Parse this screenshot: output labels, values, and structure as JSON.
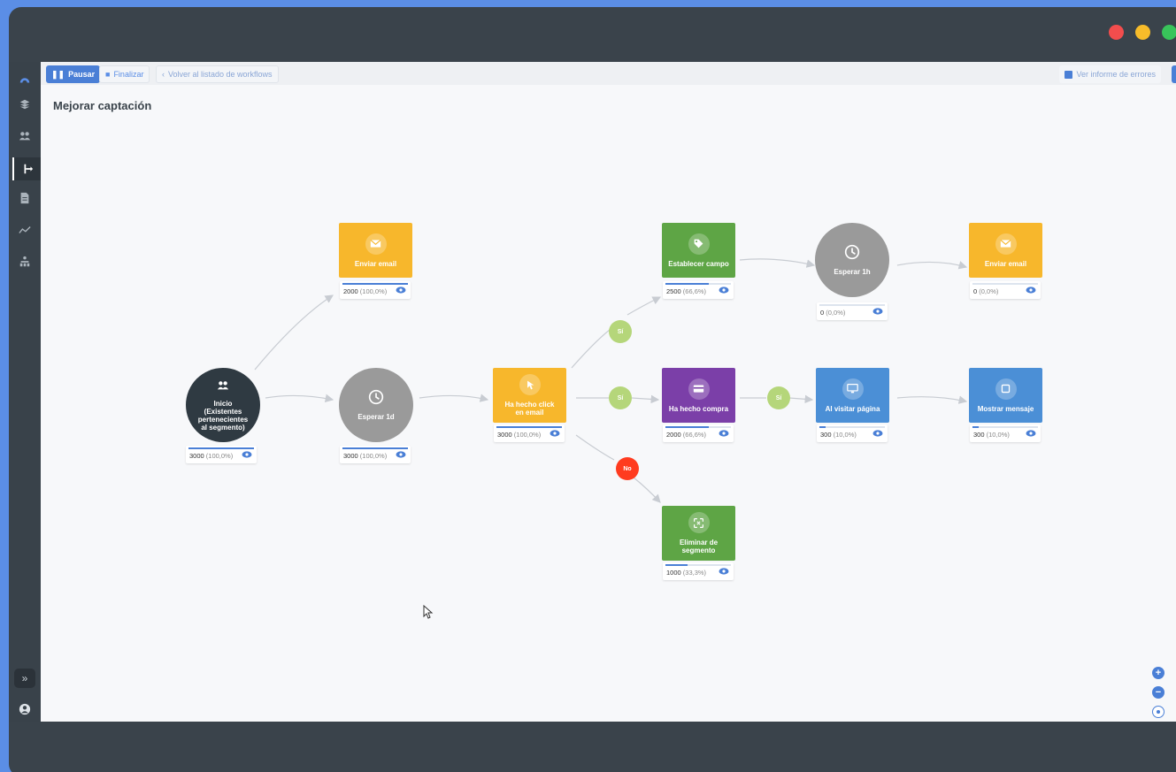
{
  "window": {
    "dots": [
      {
        "name": "close",
        "color": "#f24d4d"
      },
      {
        "name": "minimize",
        "color": "#f7bc2a"
      },
      {
        "name": "maximize",
        "color": "#38c45a"
      }
    ]
  },
  "toolbar": {
    "pause_label": "Pausar",
    "finish_label": "Finalizar",
    "back_label": "Volver al listado de workflows",
    "right_label": "Ver informe de errores"
  },
  "page": {
    "title": "Mejorar captación"
  },
  "colors": {
    "accent": "#4a7fd6",
    "dark": "#2f3a42",
    "gray": "#9a9a9a",
    "yellow": "#f7b72c",
    "green": "#5ea545",
    "purple": "#7b3fa8",
    "blue": "#4b8fd6",
    "cond_green": "#b5d67a",
    "cond_red": "#ff3b1f"
  },
  "nodes": [
    {
      "id": "start",
      "label": "Inicio (Existentes pertenecientes al segmento)",
      "icon": "users-icon",
      "count": "3000",
      "pct": "(100,0%)",
      "fill": 1.0
    },
    {
      "id": "email1",
      "label": "Enviar email",
      "icon": "mail-icon",
      "count": "2000",
      "pct": "(100,0%)",
      "fill": 1.0
    },
    {
      "id": "wait1",
      "label": "Esperar 1d",
      "icon": "clock-icon",
      "count": "3000",
      "pct": "(100,0%)",
      "fill": 1.0
    },
    {
      "id": "click",
      "label": "Ha hecho click en email",
      "icon": "pointer-icon",
      "count": "3000",
      "pct": "(100,0%)",
      "fill": 1.0
    },
    {
      "id": "setfield",
      "label": "Establecer campo",
      "icon": "tag-icon",
      "count": "2500",
      "pct": "(66,6%)",
      "fill": 0.666
    },
    {
      "id": "purchase",
      "label": "Ha hecho compra",
      "icon": "card-icon",
      "count": "2000",
      "pct": "(66,6%)",
      "fill": 0.666
    },
    {
      "id": "remove",
      "label": "Eliminar de segmento",
      "icon": "remove-icon",
      "count": "1000",
      "pct": "(33,3%)",
      "fill": 0.333
    },
    {
      "id": "wait2",
      "label": "Esperar 1h",
      "icon": "clock-icon",
      "count": "0",
      "pct": "(0,0%)",
      "fill": 0.0
    },
    {
      "id": "visit",
      "label": "Al visitar página",
      "icon": "monitor-icon",
      "count": "300",
      "pct": "(10,0%)",
      "fill": 0.1
    },
    {
      "id": "email2",
      "label": "Enviar email",
      "icon": "mail-icon",
      "count": "0",
      "pct": "(0,0%)",
      "fill": 0.0
    },
    {
      "id": "message",
      "label": "Mostrar mensaje",
      "icon": "square-icon",
      "count": "300",
      "pct": "(10,0%)",
      "fill": 0.1
    }
  ],
  "conditions": [
    {
      "id": "c1",
      "label": "Sí"
    },
    {
      "id": "c2",
      "label": "Sí"
    },
    {
      "id": "c3",
      "label": "Sí"
    },
    {
      "id": "c4",
      "label": "No"
    }
  ]
}
